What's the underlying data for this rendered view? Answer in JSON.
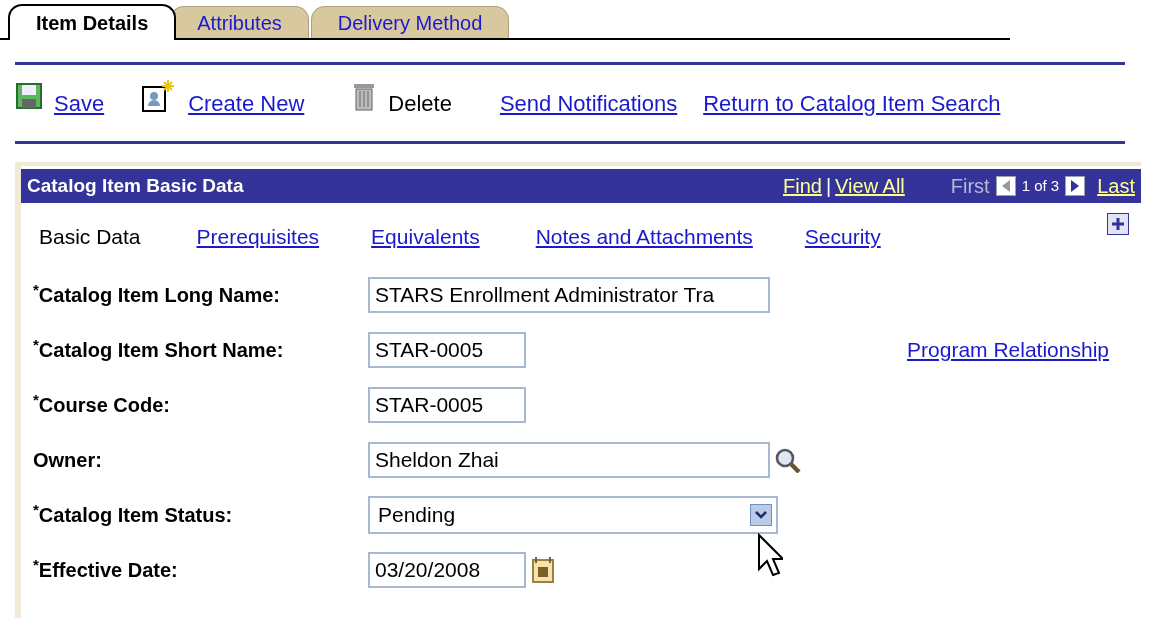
{
  "tabs": [
    {
      "label": "Item Details",
      "selected": true
    },
    {
      "label": "Attributes",
      "selected": false
    },
    {
      "label": "Delivery Method",
      "selected": false
    }
  ],
  "toolbar": [
    {
      "kind": "save",
      "label": "Save",
      "disabled": false
    },
    {
      "kind": "create",
      "label": "Create New",
      "disabled": false
    },
    {
      "kind": "delete",
      "label": "Delete",
      "disabled": true
    },
    {
      "kind": "link",
      "label": "Send Notifications",
      "disabled": false
    },
    {
      "kind": "link",
      "label": "Return to Catalog Item Search",
      "disabled": false
    }
  ],
  "panel": {
    "title": "Catalog Item Basic Data",
    "find": "Find",
    "separator": "|",
    "view_all": "View All",
    "first": "First",
    "counter": "1 of 3",
    "last": "Last",
    "subtabs": [
      {
        "label": "Basic Data",
        "selected": true
      },
      {
        "label": "Prerequisites",
        "selected": false
      },
      {
        "label": "Equivalents",
        "selected": false
      },
      {
        "label": "Notes and Attachments",
        "selected": false
      },
      {
        "label": "Security",
        "selected": false
      }
    ],
    "fields": [
      {
        "label": "$^{*}$Catalog Item Long Name:",
        "kind": "long_text",
        "value": "STARS Enrollment Administrator Tra"
      },
      {
        "label": "$^{*}$Catalog Item Short Name:",
        "kind": "short_text",
        "value": "STAR-0005",
        "link": "Program Relationship"
      },
      {
        "label": "$^{*}$Course Code:",
        "kind": "short_text",
        "value": "STAR-0005"
      },
      {
        "label": "Owner:",
        "kind": "lookup",
        "value": "Sheldon Zhai"
      },
      {
        "label": "$^{*}$Catalog Item Status:",
        "kind": "select",
        "value": "Pending"
      },
      {
        "label": "$^{*}$Effective Date:",
        "kind": "date",
        "value": "03/20/2008"
      }
    ]
  }
}
